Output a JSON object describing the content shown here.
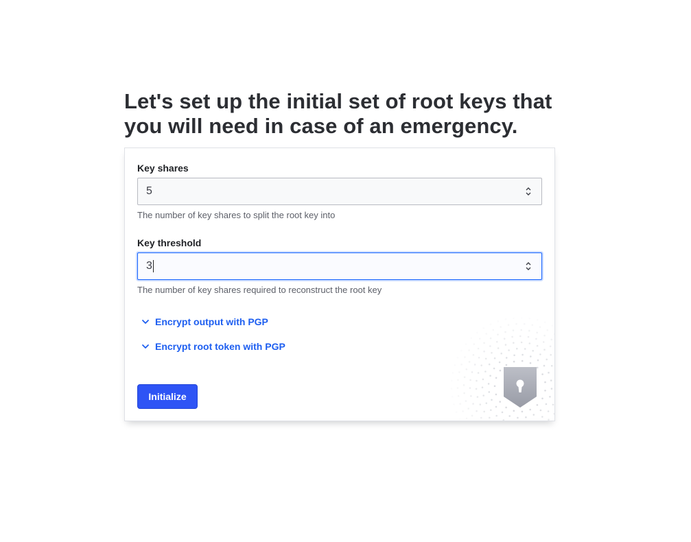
{
  "heading": "Let's set up the initial set of root keys that you will need in case of an emergency.",
  "form": {
    "key_shares": {
      "label": "Key shares",
      "value": "5",
      "help": "The number of key shares to split the root key into"
    },
    "key_threshold": {
      "label": "Key threshold",
      "value": "3",
      "help": "The number of key shares required to reconstruct the root key"
    },
    "toggles": [
      {
        "label": "Encrypt output with PGP",
        "icon": "chevron-down-icon"
      },
      {
        "label": "Encrypt root token with PGP",
        "icon": "chevron-down-icon"
      }
    ],
    "submit_label": "Initialize"
  },
  "decoration": {
    "icon": "keyhole-shield-icon"
  },
  "colors": {
    "accent": "#1d5ef0",
    "button": "#2e54f5",
    "focus_border": "#1563ff",
    "heading": "#2c2e33"
  }
}
